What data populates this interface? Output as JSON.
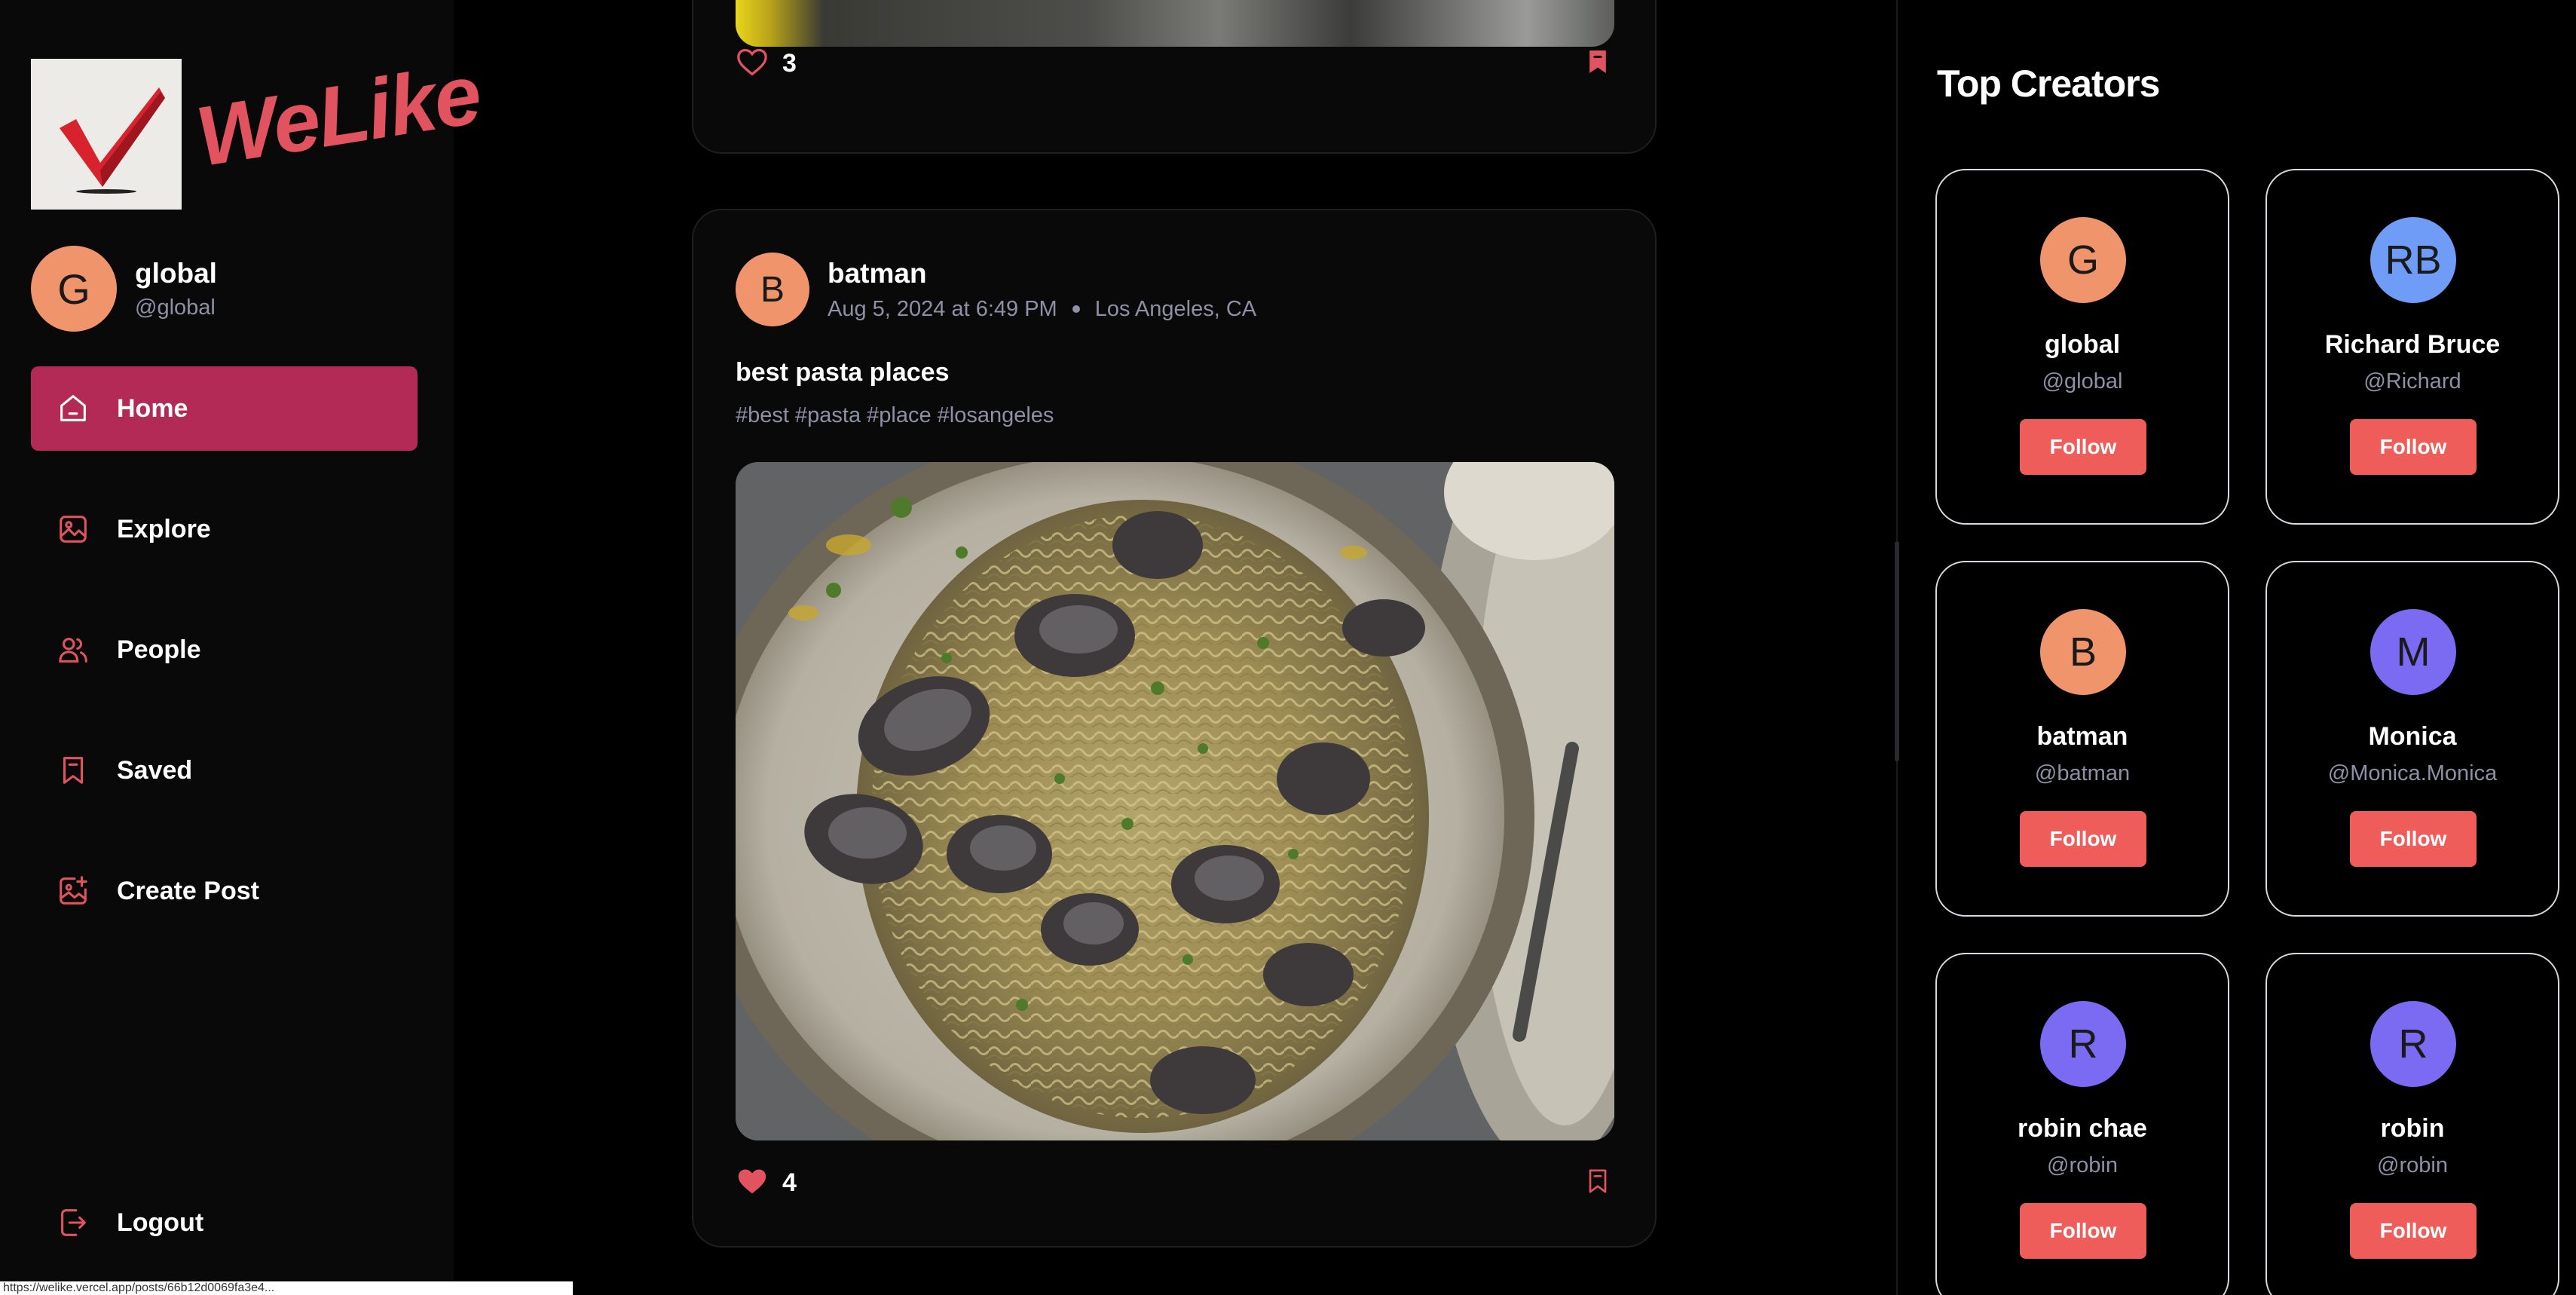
{
  "brand": {
    "name": "WeLike",
    "accent": "#e0535f"
  },
  "user": {
    "initial": "G",
    "name": "global",
    "handle": "@global",
    "avatar_color": "#f0956b"
  },
  "nav": {
    "items": [
      {
        "label": "Home",
        "icon": "home-icon",
        "active": true
      },
      {
        "label": "Explore",
        "icon": "gallery-icon",
        "active": false
      },
      {
        "label": "People",
        "icon": "people-icon",
        "active": false
      },
      {
        "label": "Saved",
        "icon": "bookmark-icon",
        "active": false
      },
      {
        "label": "Create Post",
        "icon": "add-image-icon",
        "active": false
      }
    ],
    "logout_label": "Logout",
    "active_color": "#b32a57"
  },
  "feed": {
    "previous_post": {
      "likes": "3",
      "liked": false,
      "saved": true
    },
    "post": {
      "initial": "B",
      "username": "batman",
      "date": "Aug 5, 2024 at 6:49 PM",
      "location": "Los Angeles, CA",
      "caption": "best pasta places",
      "tags": "#best #pasta #place #losangeles",
      "likes": "4",
      "liked": true,
      "saved": false
    }
  },
  "top_creators": {
    "title": "Top Creators",
    "follow_label": "Follow",
    "items": [
      {
        "initial": "G",
        "name": "global",
        "handle": "@global",
        "color": "#f0956b"
      },
      {
        "initial": "RB",
        "name": "Richard Bruce",
        "handle": "@Richard",
        "color": "#6e9cf6"
      },
      {
        "initial": "B",
        "name": "batman",
        "handle": "@batman",
        "color": "#f0956b"
      },
      {
        "initial": "M",
        "name": "Monica",
        "handle": "@Monica.Monica",
        "color": "#7b6af2"
      },
      {
        "initial": "R",
        "name": "robin chae",
        "handle": "@robin",
        "color": "#7b6af2"
      },
      {
        "initial": "R",
        "name": "robin",
        "handle": "@robin",
        "color": "#7b6af2"
      }
    ]
  },
  "status_bar": {
    "url": "https://welike.vercel.app/posts/66b12d0069fa3e4..."
  }
}
